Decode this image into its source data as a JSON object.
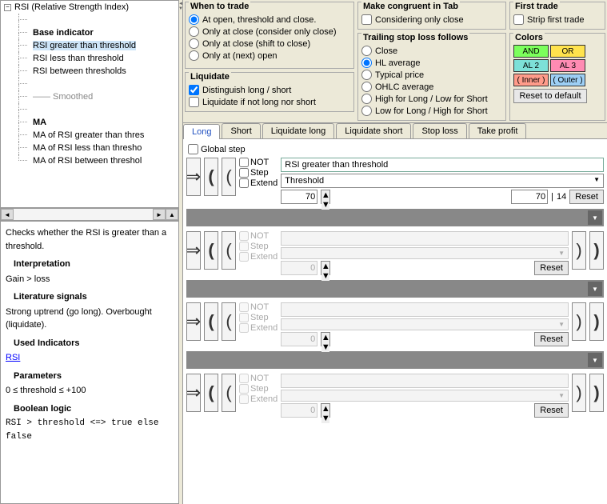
{
  "tree": {
    "root": "RSI (Relative Strength Index)",
    "items": [
      {
        "label": "",
        "empty": true
      },
      {
        "label": "Base indicator",
        "bold": true
      },
      {
        "label": "RSI greater than threshold",
        "selected": true
      },
      {
        "label": "RSI less than threshold"
      },
      {
        "label": "RSI between thresholds"
      },
      {
        "label": "",
        "empty": true
      },
      {
        "label": "—— Smoothed",
        "muted": true
      },
      {
        "label": "",
        "empty": true
      },
      {
        "label": "MA",
        "bold": true
      },
      {
        "label": "MA of RSI greater than thres"
      },
      {
        "label": "MA of RSI less than thresho"
      },
      {
        "label": "MA of RSI between threshol"
      }
    ]
  },
  "help": {
    "intro": "Checks whether the RSI is greater than a threshold.",
    "h_interp": "Interpretation",
    "interp": "Gain > loss",
    "h_lit": "Literature signals",
    "lit": "Strong uptrend (go long). Overbought (liquidate).",
    "h_used": "Used Indicators",
    "link": "RSI",
    "h_param": "Parameters",
    "param": "0 ≤ threshold ≤ +100",
    "h_bool": "Boolean logic",
    "bool": "RSI > threshold <=> true else false"
  },
  "opts": {
    "when_hdr": "When to trade",
    "when": [
      {
        "label": "At open, threshold and close.",
        "sel": true
      },
      {
        "label": "Only at close (consider only close)"
      },
      {
        "label": "Only at close (shift to close)"
      },
      {
        "label": "Only at (next) open"
      }
    ],
    "liq_hdr": "Liquidate",
    "liq": [
      {
        "label": "Distinguish long / short",
        "chk": true
      },
      {
        "label": "Liquidate if not long nor short",
        "chk": false
      }
    ],
    "cong_hdr": "Make congruent in Tab",
    "cong": {
      "label": "Considering only close",
      "chk": false
    },
    "tsl_hdr": "Trailing stop loss follows",
    "tsl": [
      {
        "label": "Close"
      },
      {
        "label": "HL average",
        "sel": true
      },
      {
        "label": "Typical price"
      },
      {
        "label": "OHLC average"
      },
      {
        "label": "High for Long / Low for Short"
      },
      {
        "label": "Low for Long / High for Short"
      }
    ],
    "ft_hdr": "First trade",
    "ft": {
      "label": "Strip first trade",
      "chk": false
    },
    "col_hdr": "Colors",
    "colors": [
      {
        "label": "AND",
        "bg": "#7cff5c"
      },
      {
        "label": "OR",
        "bg": "#ffe34d"
      },
      {
        "label": "AL 2",
        "bg": "#7de0d8"
      },
      {
        "label": "AL 3",
        "bg": "#ff8bb3"
      },
      {
        "label": "( Inner )",
        "bg": "#ff9b8a"
      },
      {
        "label": "( Outer )",
        "bg": "#9dcff5"
      }
    ],
    "reset": "Reset to default"
  },
  "tabs": [
    "Long",
    "Short",
    "Liquidate long",
    "Liquidate short",
    "Stop loss",
    "Take profit"
  ],
  "active_tab": 0,
  "gstep": "Global step",
  "flags": {
    "not": "NOT",
    "step": "Step",
    "ext": "Extend"
  },
  "rule1": {
    "title": "RSI greater than threshold",
    "select": "Threshold",
    "v1": "70",
    "v2": "70",
    "period": "14",
    "reset": "Reset"
  },
  "disabled_rule": {
    "v1": "0",
    "reset": "Reset"
  }
}
